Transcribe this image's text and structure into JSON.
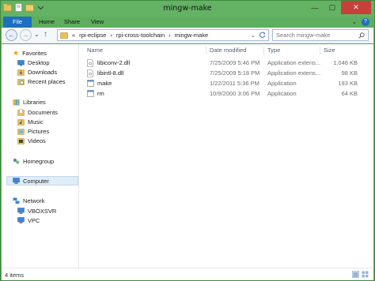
{
  "window": {
    "title": "mingw-make",
    "controls": {
      "minimize": "—",
      "maximize": "▢",
      "close": "✕"
    }
  },
  "ribbon": {
    "tabs": [
      "File",
      "Home",
      "Share",
      "View"
    ],
    "collapse_glyph": "⌄",
    "help_glyph": "?"
  },
  "nav": {
    "back_glyph": "←",
    "forward_glyph": "→",
    "recent_glyph": "⌄",
    "up_glyph": "↑",
    "address": {
      "overflow": "«",
      "segments": [
        "rpi-eclipse",
        "rpi-cross-toolchain",
        "mingw-make"
      ],
      "separator": "›"
    },
    "search": {
      "placeholder": "Search mingw-make"
    }
  },
  "sidebar": {
    "favorites": {
      "label": "Favorites",
      "items": [
        "Desktop",
        "Downloads",
        "Recent places"
      ]
    },
    "libraries": {
      "label": "Libraries",
      "items": [
        "Documents",
        "Music",
        "Pictures",
        "Videos"
      ]
    },
    "homegroup": "Homegroup",
    "computer": "Computer",
    "network": {
      "label": "Network",
      "items": [
        "VBOXSVR",
        "VPC"
      ]
    }
  },
  "files": {
    "columns": {
      "name": "Name",
      "date": "Date modified",
      "type": "Type",
      "size": "Size"
    },
    "rows": [
      {
        "name": "libiconv-2.dll",
        "date": "7/25/2009 5:46 PM",
        "type": "Application extens...",
        "size": "1,046 KB",
        "icon": "dll-file-icon"
      },
      {
        "name": "libintl-8.dll",
        "date": "7/25/2009 5:18 PM",
        "type": "Application extens...",
        "size": "98 KB",
        "icon": "dll-file-icon"
      },
      {
        "name": "make",
        "date": "1/22/2011 5:36 PM",
        "type": "Application",
        "size": "193 KB",
        "icon": "exe-file-icon"
      },
      {
        "name": "rm",
        "date": "10/9/2000 3:06 PM",
        "type": "Application",
        "size": "64 KB",
        "icon": "exe-file-icon"
      }
    ]
  },
  "status": {
    "item_count": "4 items"
  },
  "colors": {
    "titlebar": "#64b264",
    "file_tab": "#1f6fc0",
    "close": "#c7403a",
    "selection": "#e0ecf8"
  }
}
